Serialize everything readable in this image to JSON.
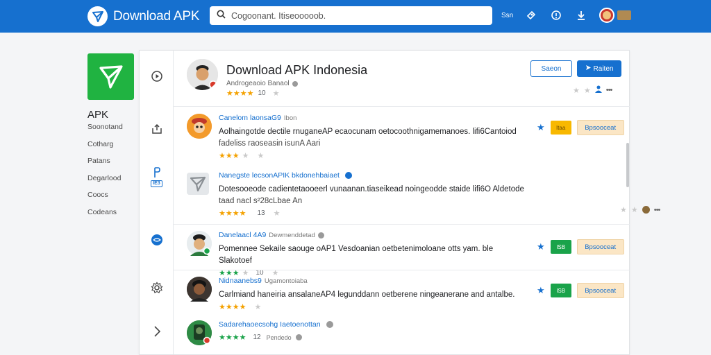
{
  "topbar": {
    "brand": "Download APK",
    "search_placeholder": "Cogoonant. Itiseooooob.",
    "link": "Ssn"
  },
  "app": {
    "title": "APK",
    "links": [
      "Soonotand",
      "Cotharg",
      "Patans",
      "Degarlood",
      "Coocs",
      "Codeans"
    ]
  },
  "header": {
    "title": "Download APK Indonesia",
    "subtitle": "Androgeaoio Banaol",
    "rating_count": "10",
    "outline_button": "Saeon",
    "primary_button": "Raiten"
  },
  "rows": [
    {
      "name": "Canelom laonsaG9",
      "meta": "Ibon",
      "desc1": "Aolhaingotde dectile rnuganeAP ecaocunam oetocoothnigamemanoes. lifi6Cantoiod",
      "desc2": "fadeliss raoseasin isunA Aari",
      "rating_count": "",
      "pill": "Itaa",
      "get": "Bpsooceat"
    },
    {
      "name": "Nanegste lecsonAPIK bkdonehbaiaet",
      "meta": "",
      "desc1": "Dotesooeode cadientetaooeerl vunaanan.tiaseikead noingeodde staide lifi6O Aldetode",
      "desc2": "taad nacl s²28cLbae An",
      "rating_count": "13",
      "pill": "",
      "get": ""
    },
    {
      "name": "Danelaacl 4A9",
      "meta": "Dewmenddetad",
      "desc1": "Pomennee Sekaile saouge oAP1 Vesdoanian oetbetenimoloane otts yam. ble Slakotoef",
      "desc2": "",
      "rating_count": "10",
      "pill": "ISB",
      "get": "Bpsooceat"
    },
    {
      "name": "Nidnaanebs9",
      "meta": "Ugamontoiaba",
      "desc1": "Carlmiand haneiria ansalaneAP4 legunddann oetberene ningeanerane and antalbe.",
      "desc2": "",
      "rating_count": "",
      "pill": "ISB",
      "get": "Bpsooceat"
    },
    {
      "name": "Sadarehaoecsohg Iaetoenottan",
      "meta": "",
      "desc1": "",
      "desc2": "",
      "rating_count": "12",
      "sub": "Pendedo",
      "pill": "",
      "get": ""
    }
  ],
  "colors": {
    "primary": "#1670cf",
    "app_green": "#20b341",
    "star_orange": "#f4a100",
    "star_green": "#1aa34a",
    "get_bg": "#fbe6c5"
  }
}
